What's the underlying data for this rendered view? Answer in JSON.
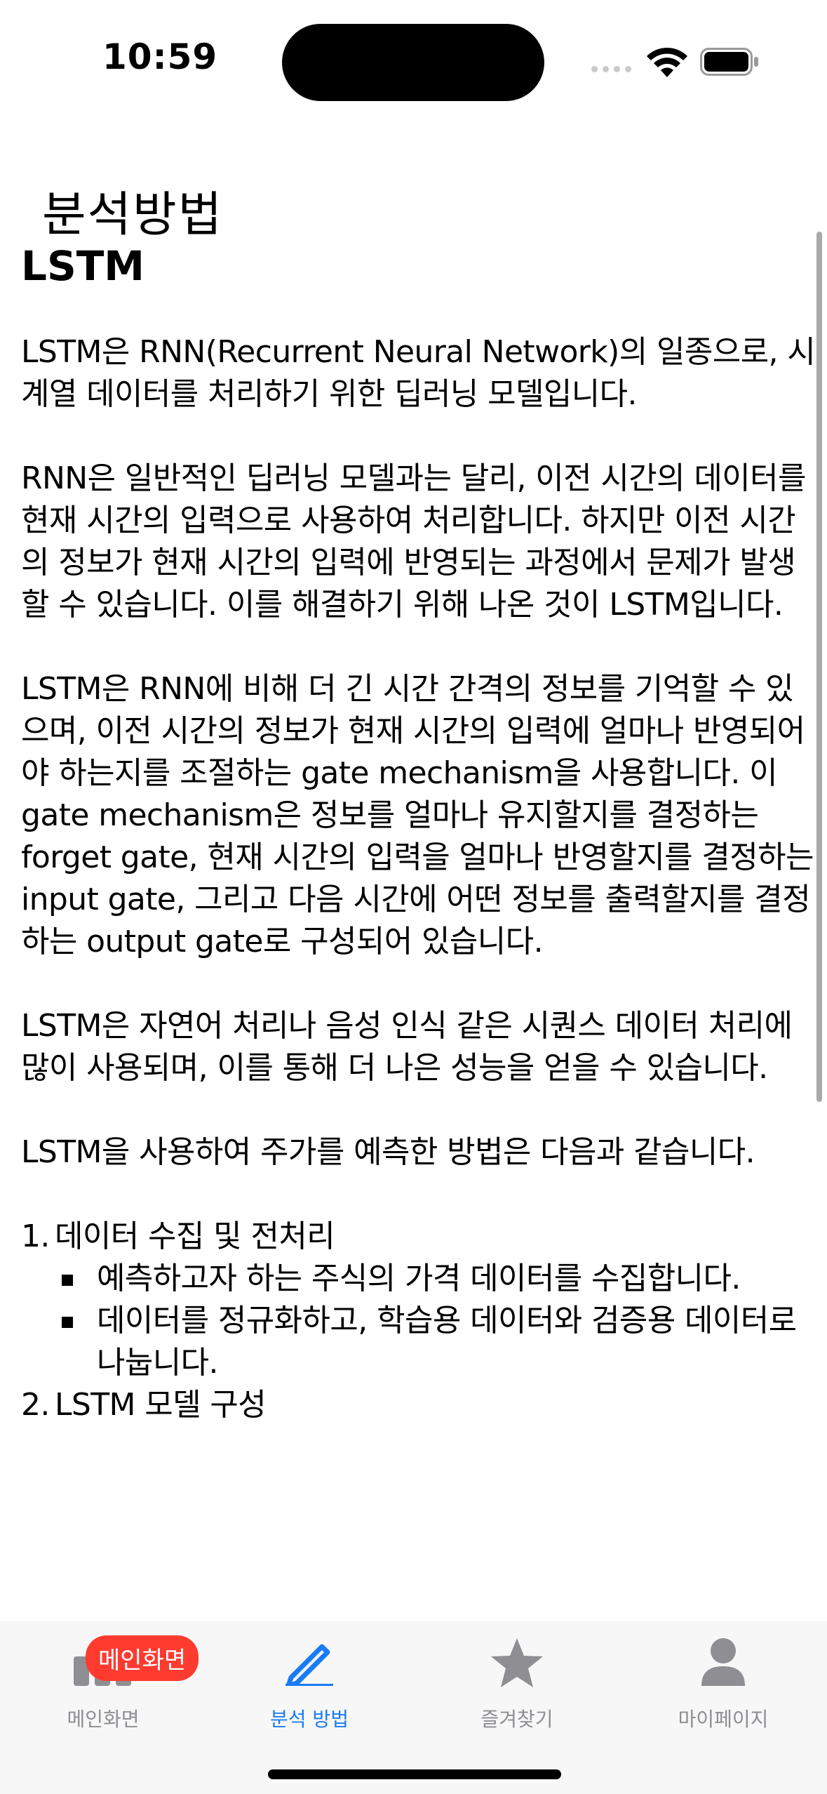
{
  "status": {
    "time": "10:59"
  },
  "page": {
    "title": "분석방법"
  },
  "article": {
    "heading": "LSTM",
    "paragraphs": [
      "LSTM은 RNN(Recurrent Neural Network)의 일종으로, 시계열 데이터를 처리하기 위한 딥러닝 모델입니다.",
      "RNN은 일반적인 딥러닝 모델과는 달리, 이전 시간의 데이터를 현재 시간의 입력으로 사용하여 처리합니다. 하지만 이전 시간의 정보가 현재 시간의 입력에 반영되는 과정에서 문제가 발생할 수 있습니다. 이를 해결하기 위해 나온 것이 LSTM입니다.",
      "LSTM은 RNN에 비해 더 긴 시간 간격의 정보를 기억할 수 있으며, 이전 시간의 정보가 현재 시간의 입력에 얼마나 반영되어야 하는지를 조절하는 gate mechanism을 사용합니다. 이 gate mechanism은 정보를 얼마나 유지할지를 결정하는 forget gate, 현재 시간의 입력을 얼마나 반영할지를 결정하는 input gate, 그리고 다음 시간에 어떤 정보를 출력할지를 결정하는 output gate로 구성되어 있습니다.",
      "LSTM은 자연어 처리나 음성 인식 같은 시퀀스 데이터 처리에 많이 사용되며, 이를 통해 더 나은 성능을 얻을 수 있습니다.",
      "LSTM을 사용하여 주가를 예측한 방법은 다음과 같습니다."
    ],
    "steps": [
      {
        "num": "1.",
        "title": "데이터 수집 및 전처리",
        "items": [
          "예측하고자 하는 주식의 가격 데이터를 수집합니다.",
          "데이터를 정규화하고, 학습용 데이터와 검증용 데이터로 나눕니다."
        ]
      },
      {
        "num": "2.",
        "title": "LSTM 모델 구성",
        "items": []
      }
    ]
  },
  "tabbar": {
    "badge": "메인화면",
    "tabs": [
      {
        "label": "메인화면",
        "icon": "chart-bars-icon"
      },
      {
        "label": "분석 방법",
        "icon": "pencil-icon"
      },
      {
        "label": "즐겨찾기",
        "icon": "star-icon"
      },
      {
        "label": "마이페이지",
        "icon": "person-icon"
      }
    ],
    "active_color": "#1a7cf5",
    "inactive_color": "#8e8e93",
    "badge_color": "#ff3b30"
  }
}
